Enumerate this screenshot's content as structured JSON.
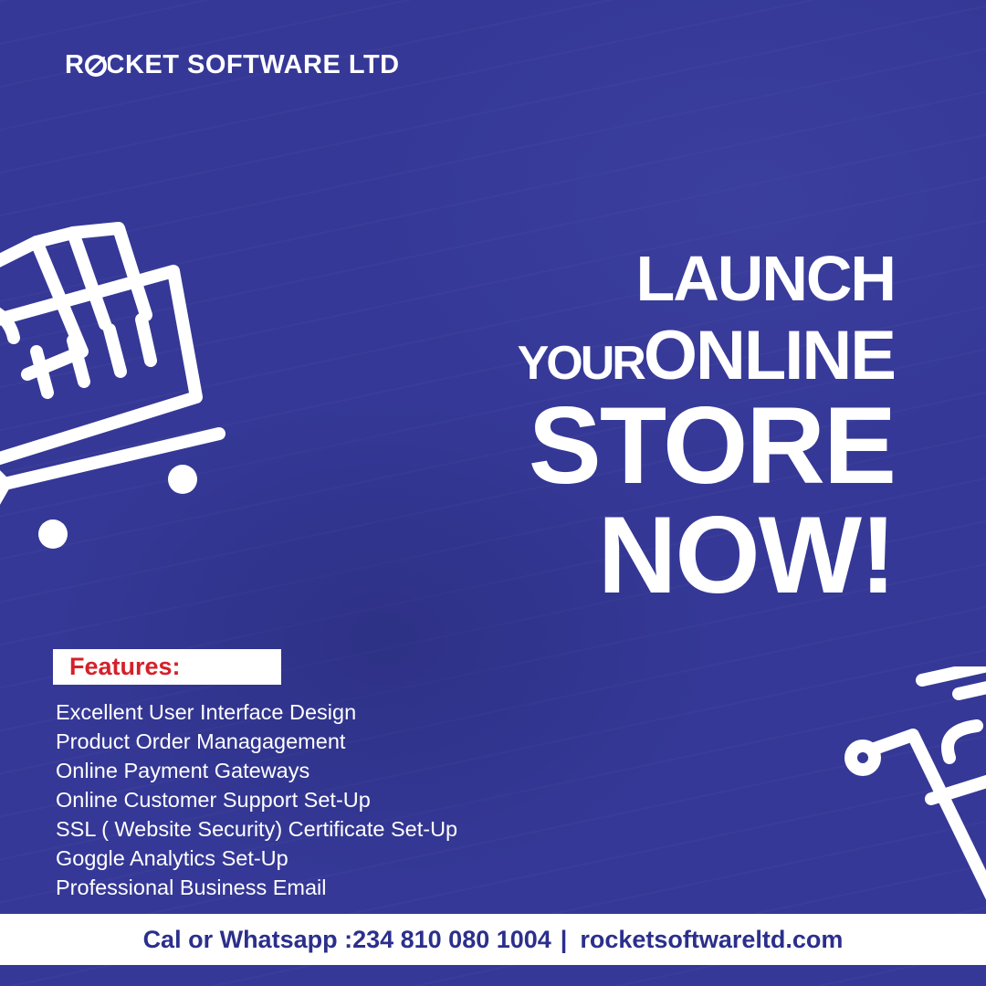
{
  "brand": {
    "name": "ROCKET SOFTWARE LTD",
    "logo_icon": "rocket-o-icon",
    "text_color": "#ffffff"
  },
  "headline": {
    "line1": "LAUNCH",
    "line2a": "YOUR",
    "line2b": "ONLINE",
    "line3": "STORE",
    "line4": "NOW!"
  },
  "features": {
    "label": "Features:",
    "label_color": "#d5202a",
    "items": [
      "Excellent User Interface Design",
      "Product Order Managagement",
      "Online Payment Gateways",
      "Online Customer Support Set-Up",
      "SSL ( Website Security) Certificate Set-Up",
      "Goggle Analytics Set-Up",
      "Professional Business Email"
    ]
  },
  "footer": {
    "contact": "Cal or Whatsapp :234 810 080 1004",
    "separator": "|",
    "website": "rocketsoftwareltd.com",
    "text_color": "#2b2f8c"
  },
  "decorations": {
    "left_icon": "shopping-cart-icon",
    "right_icon": "shopping-cart-icon"
  },
  "colors": {
    "background": "#353896",
    "white": "#ffffff"
  }
}
